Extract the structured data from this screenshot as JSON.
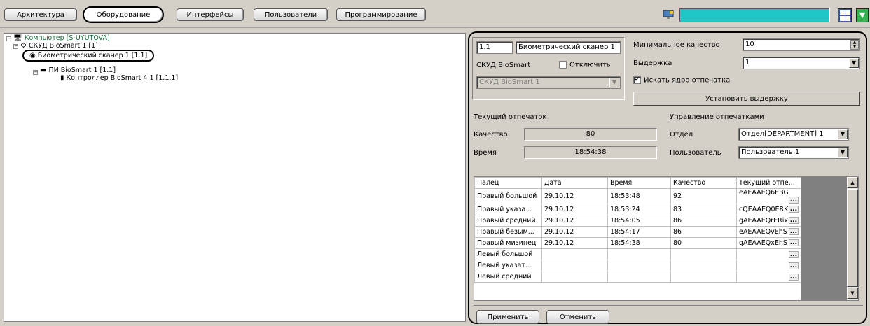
{
  "tabs": [
    "Архитектура",
    "Оборудование",
    "Интерфейсы",
    "Пользователи",
    "Программирование"
  ],
  "tree": {
    "computer": "Компьютер [S-UYUTOVA]",
    "skud": "СКУД BioSmart 1 [1]",
    "scanner": "Биометрический сканер 1 [1.1]",
    "pi": "ПИ BioSmart 1 [1.1]",
    "controller": "Контроллер BioSmart 4 1 [1.1.1]"
  },
  "panel": {
    "id": "1.1",
    "name": "Биометрический сканер 1",
    "parent_label": "СКУД BioSmart",
    "disable_label": "Отключить",
    "parent_value": "СКУД BioSmart 1",
    "min_quality_label": "Минимальное качество",
    "min_quality_value": "10",
    "exposure_label": "Выдержка",
    "exposure_value": "1",
    "search_core_label": "Искать ядро отпечатка",
    "set_exposure_button": "Установить выдержку",
    "current_print_label": "Текущий отпечаток",
    "quality_label": "Качество",
    "quality_value": "80",
    "time_label": "Время",
    "time_value": "18:54:38",
    "print_mgmt_label": "Управление отпечатками",
    "dept_label": "Отдел",
    "dept_value": "Отдел[DEPARTMENT] 1",
    "user_label": "Пользователь",
    "user_value": "Пользователь 1",
    "apply_button": "Применить",
    "cancel_button": "Отменить"
  },
  "table": {
    "headers": [
      "Палец",
      "Дата",
      "Время",
      "Качество",
      "Текущий отпе..."
    ],
    "rows": [
      [
        "Правый большой",
        "29.10.12",
        "18:53:48",
        "92",
        "eAEAAEQ6EBG"
      ],
      [
        "Правый указа...",
        "29.10.12",
        "18:53:24",
        "83",
        "cQEAAEQ0ERK"
      ],
      [
        "Правый средний",
        "29.10.12",
        "18:54:05",
        "86",
        "gAEAAEQrERix"
      ],
      [
        "Правый безым...",
        "29.10.12",
        "18:54:17",
        "86",
        "eAEAAEQvEhS"
      ],
      [
        "Правый мизинец",
        "29.10.12",
        "18:54:38",
        "80",
        "gAEAAEQxEhS"
      ],
      [
        "Левый большой",
        "",
        "",
        "",
        ""
      ],
      [
        "Левый указат...",
        "",
        "",
        "",
        ""
      ],
      [
        "Левый средний",
        "",
        "",
        "",
        ""
      ]
    ],
    "more_button": "..."
  }
}
